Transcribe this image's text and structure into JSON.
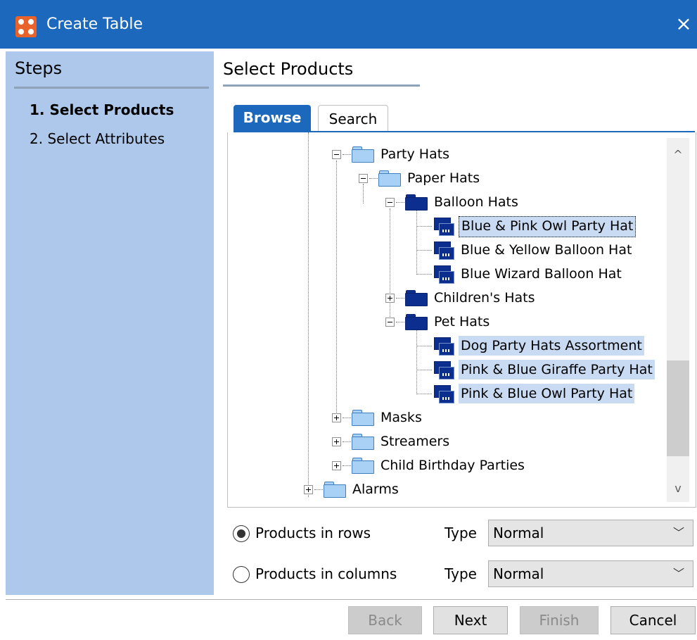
{
  "window": {
    "title": "Create Table",
    "close_icon": "×"
  },
  "steps": {
    "heading": "Steps",
    "items": [
      {
        "label": "1. Select Products"
      },
      {
        "label": "2. Select Attributes"
      }
    ]
  },
  "main": {
    "heading": "Select Products",
    "tabs": [
      {
        "label": "Browse",
        "active": true
      },
      {
        "label": "Search",
        "active": false
      }
    ]
  },
  "tree": {
    "nodes": [
      {
        "label": "Party Hats",
        "icon": "folder-icon",
        "state": "expanded"
      },
      {
        "label": "Paper Hats",
        "icon": "folder-icon",
        "state": "expanded"
      },
      {
        "label": "Balloon Hats",
        "icon": "dark-folder-icon",
        "state": "expanded"
      },
      {
        "label": "Blue & Pink Owl Party Hat",
        "icon": "product-icon",
        "selected": true,
        "focused": true
      },
      {
        "label": "Blue & Yellow Balloon Hat",
        "icon": "product-icon"
      },
      {
        "label": "Blue Wizard Balloon Hat",
        "icon": "product-icon"
      },
      {
        "label": "Children's Hats",
        "icon": "dark-folder-icon",
        "state": "collapsed"
      },
      {
        "label": "Pet Hats",
        "icon": "dark-folder-icon",
        "state": "expanded"
      },
      {
        "label": "Dog Party Hats Assortment",
        "icon": "product-icon",
        "selected": true
      },
      {
        "label": "Pink & Blue Giraffe Party Hat",
        "icon": "product-icon",
        "selected": true
      },
      {
        "label": "Pink & Blue Owl Party Hat",
        "icon": "product-icon",
        "selected": true
      },
      {
        "label": "Masks",
        "icon": "folder-icon",
        "state": "collapsed"
      },
      {
        "label": "Streamers",
        "icon": "folder-icon",
        "state": "collapsed"
      },
      {
        "label": "Child Birthday Parties",
        "icon": "folder-icon",
        "state": "collapsed"
      },
      {
        "label": "Alarms",
        "icon": "folder-icon",
        "state": "collapsed"
      }
    ],
    "scroll_up_icon": "^",
    "scroll_down_icon": "v"
  },
  "options": {
    "rows": {
      "label": "Products in rows",
      "checked": true,
      "type_label": "Type",
      "type_value": "Normal"
    },
    "columns": {
      "label": "Products in columns",
      "checked": false,
      "type_label": "Type",
      "type_value": "Normal"
    },
    "dropdown_icon": "﹀"
  },
  "buttons": {
    "back": "Back",
    "next": "Next",
    "finish": "Finish",
    "cancel": "Cancel"
  },
  "colors": {
    "titlebar": "#1b68bd",
    "steps_panel": "#adc8ea",
    "selection": "#c9dbf3",
    "app_icon": "#e8622a"
  }
}
